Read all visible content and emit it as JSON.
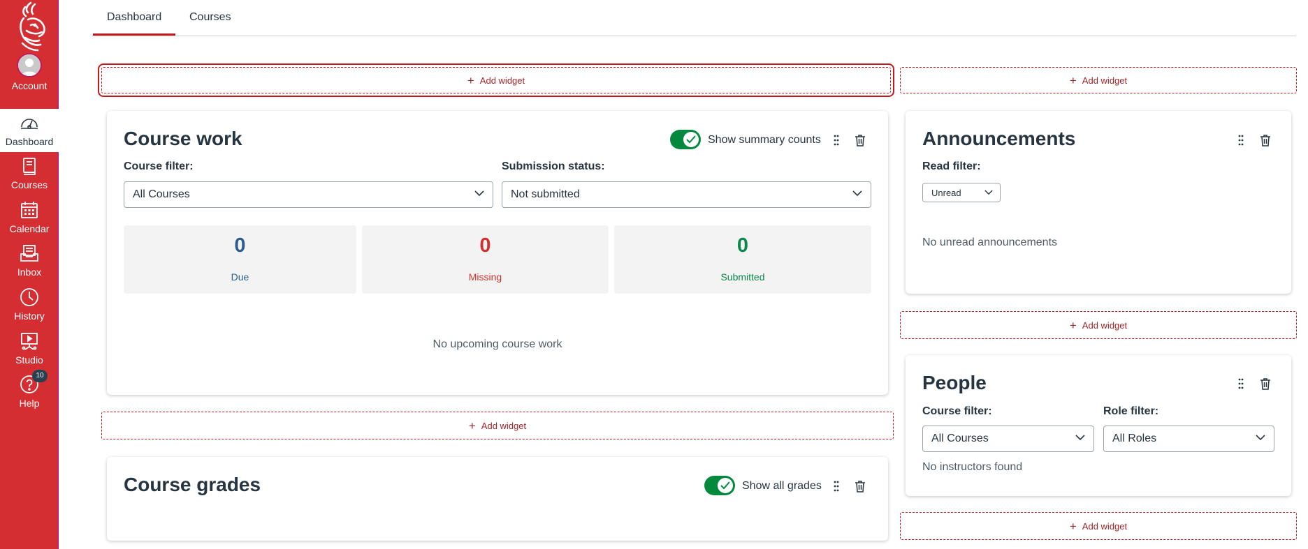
{
  "nav": {
    "items": [
      {
        "label": "Account",
        "icon": "user-avatar-icon"
      },
      {
        "label": "Dashboard",
        "icon": "dashboard-icon"
      },
      {
        "label": "Courses",
        "icon": "courses-icon"
      },
      {
        "label": "Calendar",
        "icon": "calendar-icon"
      },
      {
        "label": "Inbox",
        "icon": "inbox-icon"
      },
      {
        "label": "History",
        "icon": "clock-icon"
      },
      {
        "label": "Studio",
        "icon": "studio-icon"
      },
      {
        "label": "Help",
        "icon": "help-icon"
      }
    ],
    "help_badge": "10",
    "colors": {
      "brand": "#d42e32",
      "active_border": "#b8246a"
    }
  },
  "tabs": [
    {
      "label": "Dashboard",
      "active": true
    },
    {
      "label": "Courses",
      "active": false
    }
  ],
  "add_widget_label": "Add widget",
  "course_work": {
    "title": "Course work",
    "toggle_label": "Show summary counts",
    "toggle_on": true,
    "course_filter_label": "Course filter:",
    "course_filter_value": "All Courses",
    "submission_label": "Submission status:",
    "submission_value": "Not submitted",
    "counts": [
      {
        "value": "0",
        "label": "Due",
        "color": "#2b5d8f"
      },
      {
        "value": "0",
        "label": "Missing",
        "color": "#d0312d"
      },
      {
        "value": "0",
        "label": "Submitted",
        "color": "#0b874b"
      }
    ],
    "empty_text": "No upcoming course work"
  },
  "course_grades": {
    "title": "Course grades",
    "toggle_label": "Show all grades",
    "toggle_on": true
  },
  "announcements": {
    "title": "Announcements",
    "read_filter_label": "Read filter:",
    "read_filter_value": "Unread",
    "empty_text": "No unread announcements"
  },
  "people": {
    "title": "People",
    "course_filter_label": "Course filter:",
    "course_filter_value": "All Courses",
    "role_filter_label": "Role filter:",
    "role_filter_value": "All Roles",
    "empty_text": "No instructors found"
  },
  "colors": {
    "accent": "#c4181c",
    "toggle_on": "#03893d",
    "text": "#273540"
  }
}
